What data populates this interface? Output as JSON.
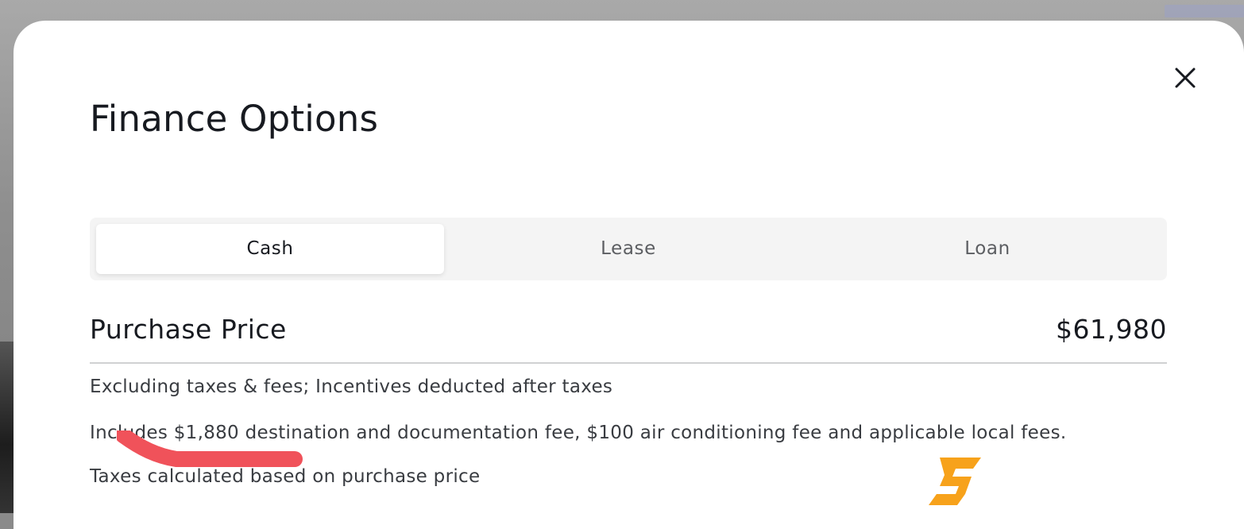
{
  "dialog": {
    "title": "Finance Options",
    "close_icon": "close-icon"
  },
  "tabs": [
    {
      "label": "Cash",
      "active": true
    },
    {
      "label": "Lease",
      "active": false
    },
    {
      "label": "Loan",
      "active": false
    }
  ],
  "purchase": {
    "label": "Purchase Price",
    "value": "$61,980"
  },
  "notes": [
    "Excluding taxes & fees; Incentives deducted after taxes",
    "Includes $1,880 destination and documentation fee, $100 air conditioning fee and applicable local fees.",
    "Taxes calculated based on purchase price"
  ],
  "colors": {
    "text_primary": "#171a20",
    "text_secondary": "#393c41",
    "tab_inactive_text": "#5c5e62",
    "tabs_background": "#f4f4f4",
    "annotation_mark": "#f0525a",
    "logo_accent": "#f7a21b"
  }
}
